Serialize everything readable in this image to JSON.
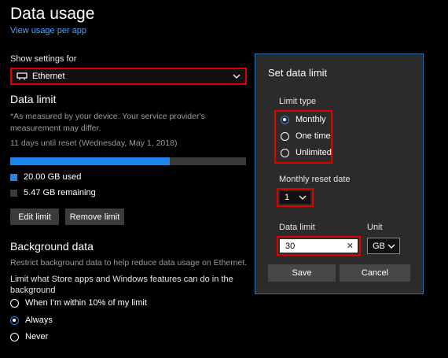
{
  "header": {
    "title": "Data usage",
    "link": "View usage per app"
  },
  "show_settings": {
    "label": "Show settings for",
    "selected": "Ethernet"
  },
  "data_limit": {
    "heading": "Data limit",
    "note": "*As measured by your device. Your service provider's measurement may differ.",
    "reset_text": "11 days until reset (Wednesday, May 1, 2018)",
    "used_fraction": 0.675,
    "used_label": "20.00 GB used",
    "remaining_label": "5.47 GB remaining",
    "edit_button": "Edit limit",
    "remove_button": "Remove limit"
  },
  "background_data": {
    "heading": "Background data",
    "desc": "Restrict background data to help reduce data usage on Ethernet.",
    "question": "Limit what Store apps and Windows features can do in the background",
    "options": [
      "When I'm within 10% of my limit",
      "Always",
      "Never"
    ],
    "selected": "Always"
  },
  "dialog": {
    "title": "Set data limit",
    "limit_type_label": "Limit type",
    "limit_types": [
      "Monthly",
      "One time",
      "Unlimited"
    ],
    "limit_type_selected": "Monthly",
    "reset_date_label": "Monthly reset date",
    "reset_date_value": "1",
    "data_limit_label": "Data limit",
    "data_limit_value": "30",
    "unit_label": "Unit",
    "unit_value": "GB",
    "save_button": "Save",
    "cancel_button": "Cancel"
  },
  "colors": {
    "accent": "#1c86ee",
    "highlight": "#e00000",
    "dialog_bg": "#2b2b2b"
  }
}
